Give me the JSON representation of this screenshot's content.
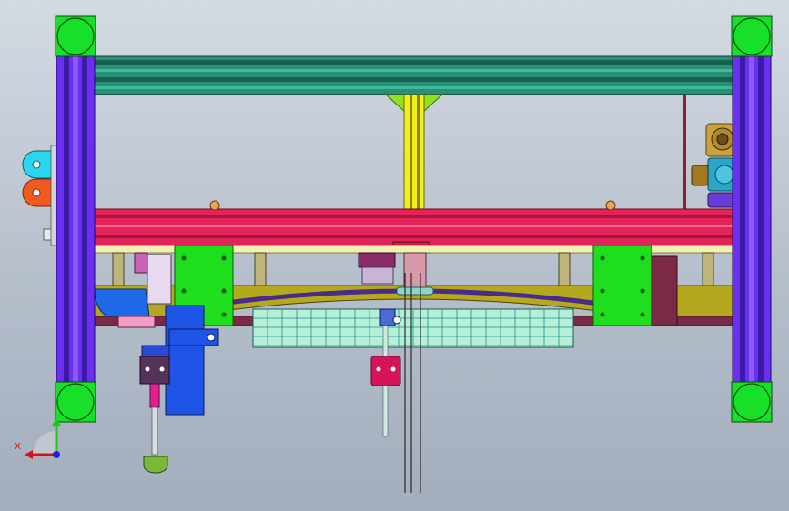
{
  "viewport": {
    "background_top": "#d4dae2",
    "background_bottom": "#a3adbb"
  },
  "colors": {
    "frame_column": "#6a2ff0",
    "frame_column_dark": "#3c1aa8",
    "corner_ball": "#16e02a",
    "top_beam": "#2a8f78",
    "top_beam_dark": "#17604f",
    "main_beam": "#e3245a",
    "main_beam_dark": "#a8143c",
    "center_shaft": "#f2ee1c",
    "center_bracket": "#8ee21e",
    "green_block": "#1ede1e",
    "olive_plate": "#b3a81e",
    "mesh_panel": "#b4f0d8",
    "mesh_lines": "#2a8a8a",
    "blue_part": "#1e55e6",
    "magenta_block": "#d6145a",
    "navy_block": "#55325a",
    "cyan_tab": "#2ad6f0",
    "orange_tab": "#f05a1e"
  },
  "triad": {
    "x_label": "X",
    "y_color": "#1ec81e",
    "x_color": "#d21414",
    "z_color": "#1e1ee6"
  }
}
